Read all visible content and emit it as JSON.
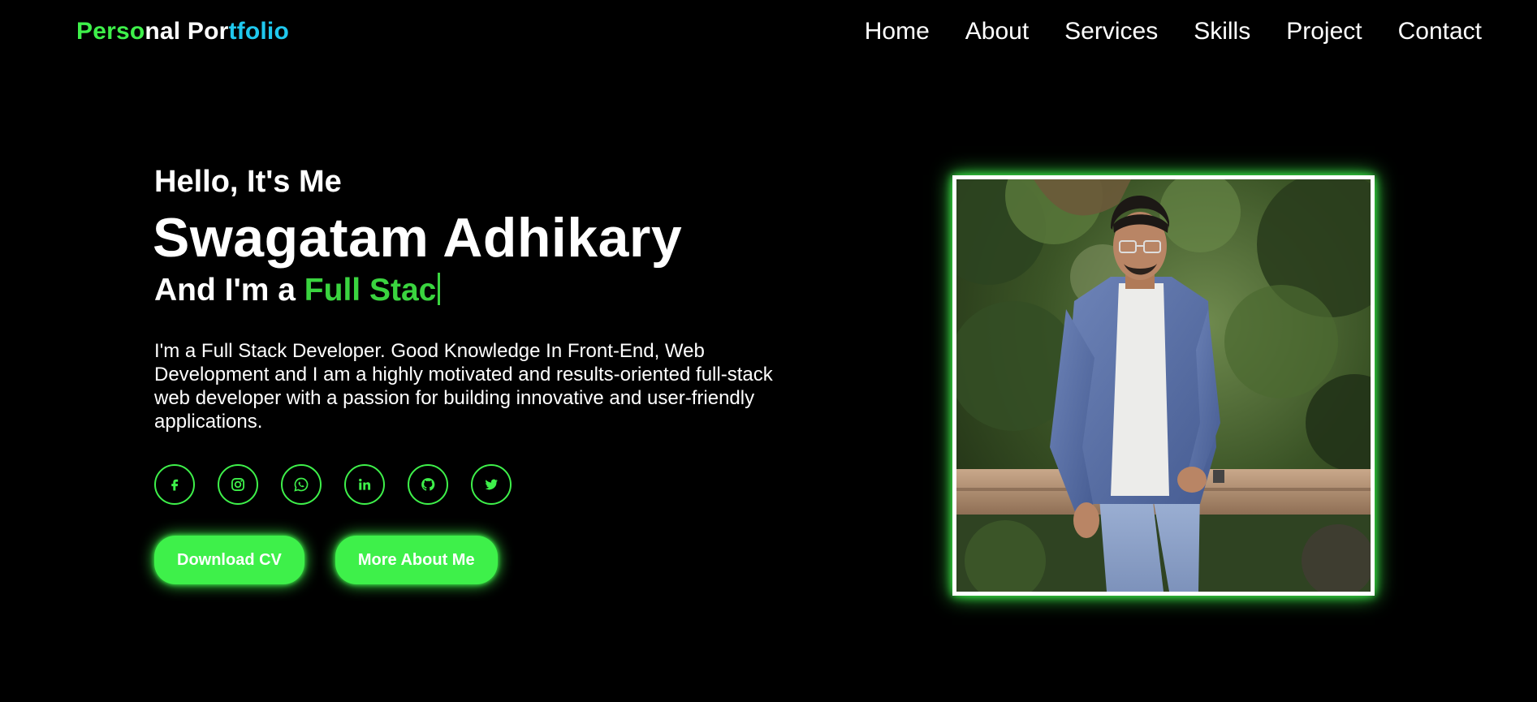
{
  "header": {
    "logo": {
      "part1": "Perso",
      "part2": "nal Por",
      "part3": "tfolio"
    },
    "nav": [
      {
        "label": "Home"
      },
      {
        "label": "About"
      },
      {
        "label": "Services"
      },
      {
        "label": "Skills"
      },
      {
        "label": "Project"
      },
      {
        "label": "Contact"
      }
    ]
  },
  "hero": {
    "greeting": "Hello, It's Me",
    "name": "Swagatam Adhikary",
    "role_prefix": "And I'm a ",
    "role_typed": "Full Stac",
    "bio": "I'm a Full Stack Developer. Good Knowledge In Front-End, Web Development and I am a highly motivated and results-oriented full-stack web developer with a passion for building innovative and user-friendly applications.",
    "socials": [
      {
        "icon": "facebook-icon"
      },
      {
        "icon": "instagram-icon"
      },
      {
        "icon": "whatsapp-icon"
      },
      {
        "icon": "linkedin-icon"
      },
      {
        "icon": "github-icon"
      },
      {
        "icon": "twitter-icon"
      }
    ],
    "buttons": {
      "download": "Download CV",
      "more": "More About Me"
    }
  },
  "colors": {
    "background": "#000000",
    "accent_green": "#3ef04a",
    "typed_green": "#3ad43f",
    "logo_cyan": "#1fc8ee",
    "text": "#ffffff"
  }
}
